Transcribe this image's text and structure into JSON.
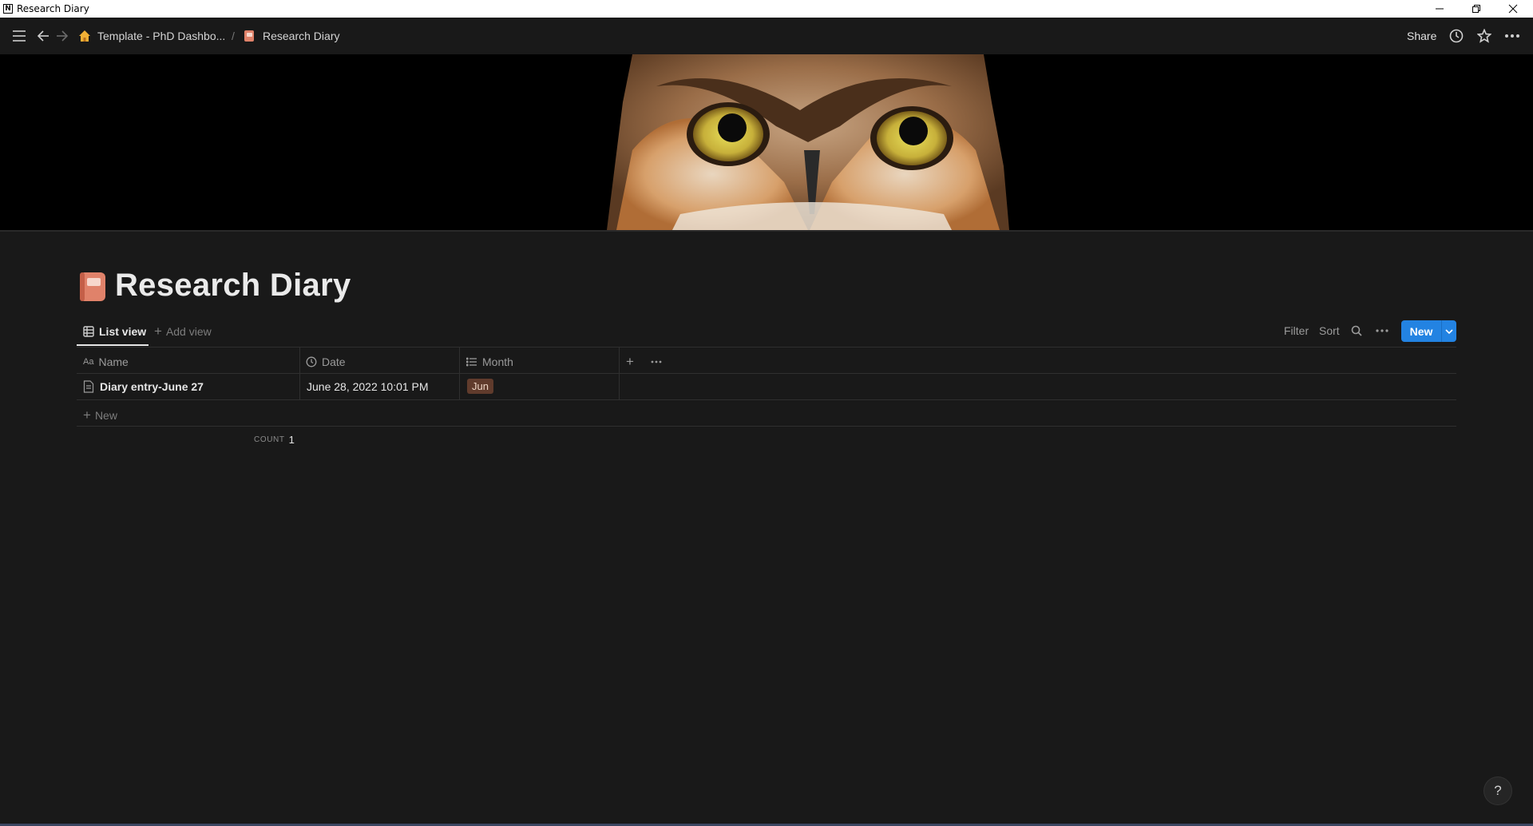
{
  "window": {
    "title": "Research Diary"
  },
  "topbar": {
    "breadcrumb": [
      {
        "label": "Template - PhD Dashbo..."
      },
      {
        "label": "Research Diary"
      }
    ],
    "separator": "/",
    "share_label": "Share"
  },
  "page": {
    "title": "Research Diary"
  },
  "views": {
    "active_tab": "List view",
    "add_view": "Add view",
    "actions": {
      "filter": "Filter",
      "sort": "Sort"
    },
    "new_button": "New"
  },
  "table": {
    "columns": [
      {
        "label": "Name",
        "icon": "text-icon"
      },
      {
        "label": "Date",
        "icon": "clock-icon"
      },
      {
        "label": "Month",
        "icon": "list-icon"
      }
    ],
    "rows": [
      {
        "name": "Diary entry-June 27",
        "date": "June 28, 2022 10:01 PM",
        "month": "Jun"
      }
    ],
    "new_row_label": "New",
    "count_label": "COUNT",
    "count_value": "1"
  },
  "help": {
    "label": "?"
  },
  "colors": {
    "background": "#191919",
    "accent": "#2383e2",
    "tag_bg": "#603b2c"
  }
}
